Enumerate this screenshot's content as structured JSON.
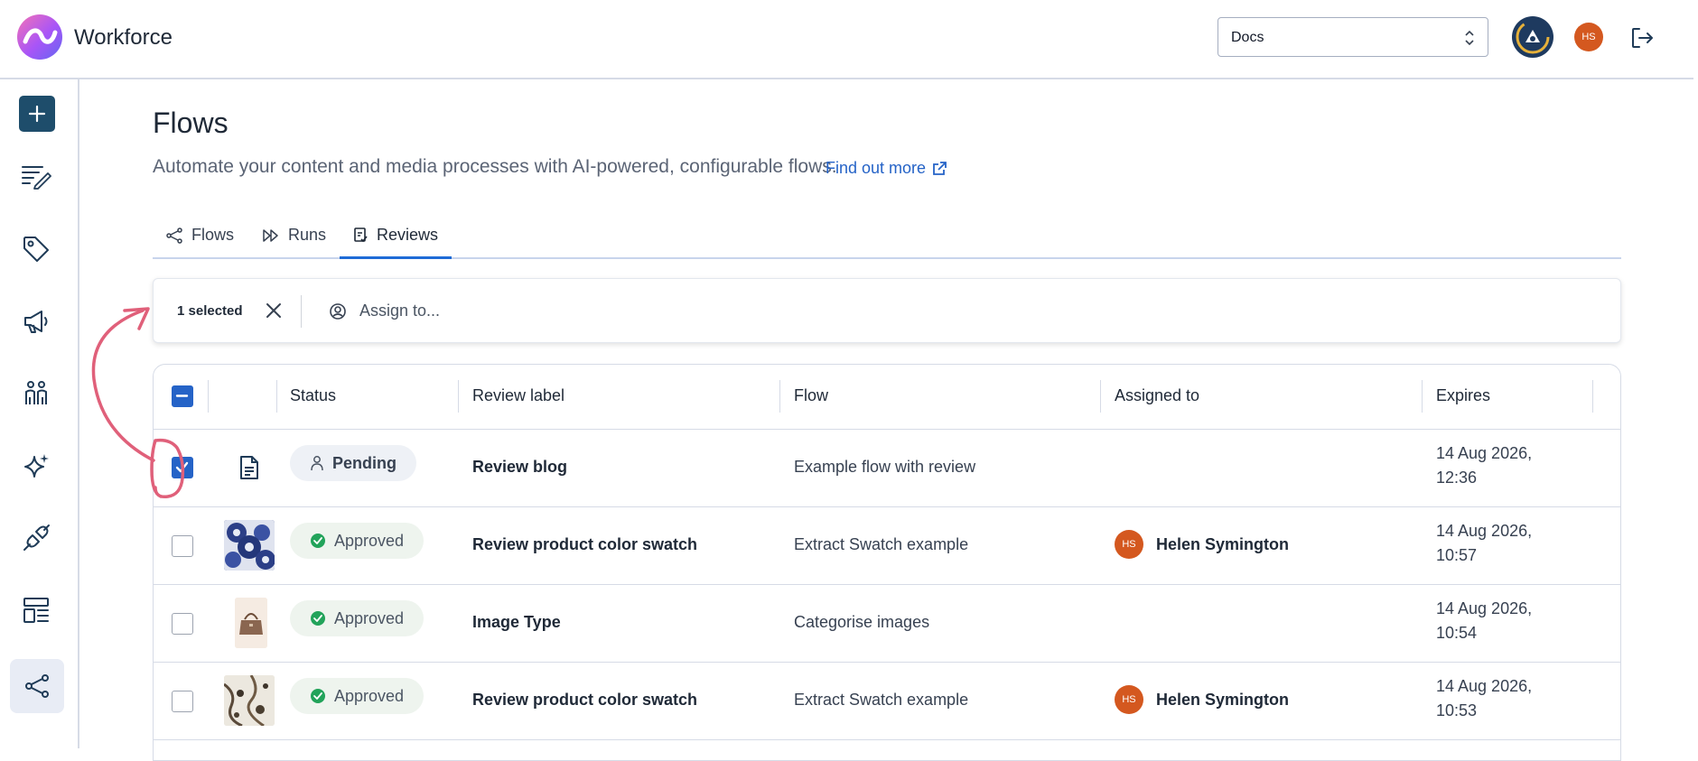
{
  "app": {
    "brand": "Workforce"
  },
  "header": {
    "select_value": "Docs",
    "user_initials": "HS"
  },
  "page": {
    "title": "Flows",
    "description": "Automate your content and media processes with AI-powered, configurable flows.",
    "find_more": "Find out more"
  },
  "tabs": [
    {
      "label": "Flows"
    },
    {
      "label": "Runs"
    },
    {
      "label": "Reviews"
    }
  ],
  "bulk": {
    "selected": "1 selected",
    "assign_placeholder": "Assign to..."
  },
  "table": {
    "headers": {
      "status": "Status",
      "label": "Review label",
      "flow": "Flow",
      "assigned": "Assigned to",
      "expires": "Expires"
    },
    "rows": [
      {
        "status": "Pending",
        "label": "Review blog",
        "flow": "Example flow with review",
        "assigned_initials": "",
        "assigned_name": "",
        "expires_date": "14 Aug 2026,",
        "expires_time": "12:36",
        "checked": true
      },
      {
        "status": "Approved",
        "label": "Review product color swatch",
        "flow": "Extract Swatch example",
        "assigned_initials": "HS",
        "assigned_name": "Helen Symington",
        "expires_date": "14 Aug 2026,",
        "expires_time": "10:57",
        "checked": false
      },
      {
        "status": "Approved",
        "label": "Image Type",
        "flow": "Categorise images",
        "assigned_initials": "",
        "assigned_name": "",
        "expires_date": "14 Aug 2026,",
        "expires_time": "10:54",
        "checked": false
      },
      {
        "status": "Approved",
        "label": "Review product color swatch",
        "flow": "Extract Swatch example",
        "assigned_initials": "HS",
        "assigned_name": "Helen Symington",
        "expires_date": "14 Aug 2026,",
        "expires_time": "10:53",
        "checked": false
      }
    ]
  },
  "colors": {
    "accent": "#2563c7",
    "nav_dark": "#1e4d6b",
    "avatar": "#d4581f",
    "approved": "#22a35a",
    "annotation": "#e0607a"
  },
  "icons": [
    "logo-icon",
    "chevron-updown-icon",
    "ring-badge-icon",
    "logout-icon",
    "plus-icon",
    "edit-list-icon",
    "tag-icon",
    "megaphone-icon",
    "people-icon",
    "sparkle-icon",
    "plug-icon",
    "layout-icon",
    "flow-icon",
    "external-link-icon",
    "close-icon",
    "user-circle-icon",
    "document-icon",
    "check-circle-icon",
    "person-icon"
  ]
}
